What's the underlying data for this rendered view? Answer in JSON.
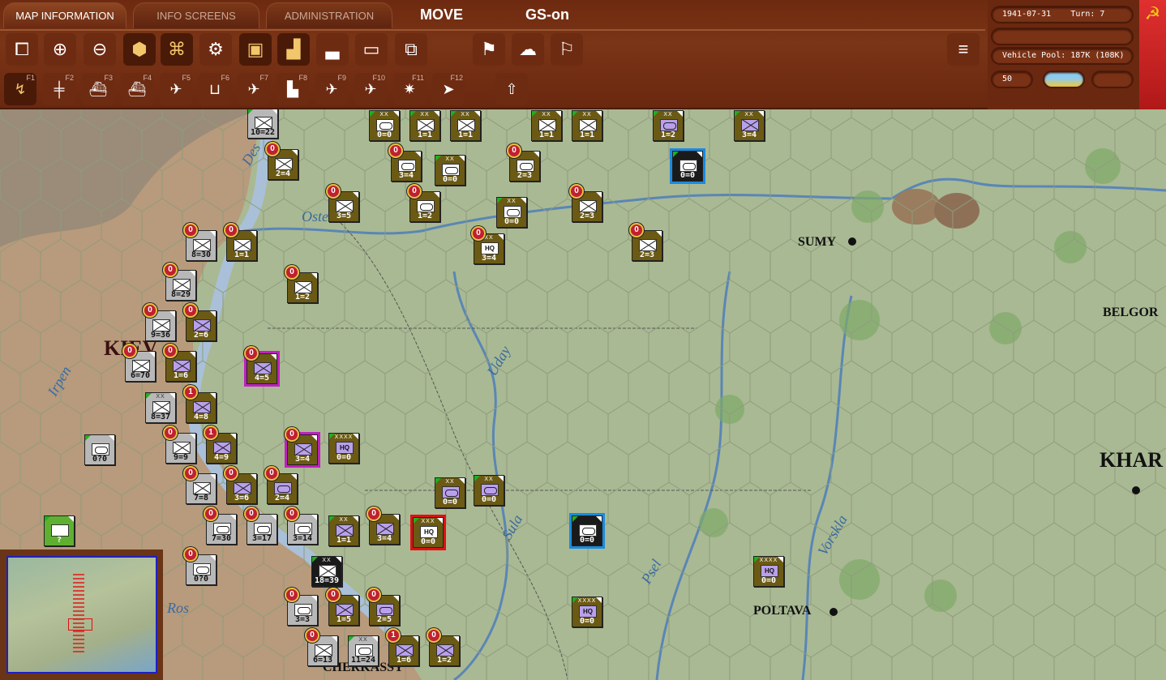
{
  "tabs": [
    {
      "label": "MAP INFORMATION",
      "active": true
    },
    {
      "label": "INFO SCREENS"
    },
    {
      "label": "ADMINISTRATION"
    }
  ],
  "modes": {
    "move": "MOVE",
    "gs": "GS-on"
  },
  "toolbar1": [
    {
      "icon": "windows-icon"
    },
    {
      "icon": "zoom-in-icon"
    },
    {
      "icon": "zoom-out-icon"
    },
    {
      "icon": "hex-grid-icon"
    },
    {
      "icon": "zoc-icon"
    },
    {
      "icon": "gear-icon"
    },
    {
      "icon": "unit-display-icon"
    },
    {
      "icon": "unit-stats-icon"
    },
    {
      "icon": "factory-icon"
    },
    {
      "icon": "frame-icon"
    },
    {
      "icon": "unit-frame-icon"
    },
    {
      "icon": "end-turn-flag-icon"
    },
    {
      "icon": "weather-icon"
    },
    {
      "icon": "flag-icon"
    },
    {
      "icon": "stack-icon"
    }
  ],
  "toolbar2": [
    {
      "icon": "move-mode-icon",
      "key": "F1"
    },
    {
      "icon": "rail-icon",
      "key": "F2"
    },
    {
      "icon": "naval-transport-icon",
      "key": "F3"
    },
    {
      "icon": "amphibious-icon",
      "key": "F4"
    },
    {
      "icon": "recon-air-icon",
      "key": "F5"
    },
    {
      "icon": "airfield-bomb-icon",
      "key": "F6"
    },
    {
      "icon": "air-superiority-icon",
      "key": "F7"
    },
    {
      "icon": "city-bomb-icon",
      "key": "F8"
    },
    {
      "icon": "airdrop-icon",
      "key": "F9"
    },
    {
      "icon": "ground-attack-icon",
      "key": "F10"
    },
    {
      "icon": "explosion-icon",
      "key": "F11"
    },
    {
      "icon": "play-icon",
      "key": "F12"
    },
    {
      "icon": "upload-icon",
      "key": ""
    }
  ],
  "status": {
    "date": "1941-07-31",
    "turn": "Turn: 7",
    "vehicle_pool": "Vehicle Pool: 187K (108K)",
    "value": "50"
  },
  "map": {
    "cities": [
      "SUMY",
      "BELGOR",
      "KHAR",
      "POLTAVA",
      "CHERKASSY",
      "KIEV"
    ],
    "rivers": [
      "Des",
      "Oster",
      "Irpen",
      "Uday",
      "Sula",
      "Psel",
      "Vorskla",
      "Ros"
    ],
    "counters": [
      {
        "st": "10=22",
        "sz": "",
        "c": "gray",
        "s": "x",
        "b": ""
      },
      {
        "st": "0=0",
        "sz": "XX",
        "c": "olive",
        "s": "oval",
        "b": ""
      },
      {
        "st": "1=1",
        "sz": "XX",
        "c": "olive",
        "s": "x",
        "b": ""
      },
      {
        "st": "1=1",
        "sz": "XX",
        "c": "olive",
        "s": "x",
        "b": ""
      },
      {
        "st": "1=1",
        "sz": "XX",
        "c": "olive",
        "s": "x",
        "b": ""
      },
      {
        "st": "1=1",
        "sz": "XX",
        "c": "olive",
        "s": "x",
        "b": ""
      },
      {
        "st": "1=2",
        "sz": "XX",
        "c": "olive",
        "s": "oval",
        "b": "",
        "p": true
      },
      {
        "st": "3=4",
        "sz": "XX",
        "c": "olive",
        "s": "x",
        "b": "",
        "p": true
      },
      {
        "st": "2=4",
        "sz": "",
        "c": "olive",
        "s": "x",
        "b": "0"
      },
      {
        "st": "3=4",
        "sz": "",
        "c": "olive",
        "s": "oval",
        "b": "0"
      },
      {
        "st": "0=0",
        "sz": "XX",
        "c": "olive",
        "s": "oval",
        "b": ""
      },
      {
        "st": "2=3",
        "sz": "",
        "c": "olive",
        "s": "oval",
        "b": "0"
      },
      {
        "st": "0=0",
        "sz": "",
        "c": "black",
        "s": "oval",
        "b": "",
        "o": "blue"
      },
      {
        "st": "3=5",
        "sz": "",
        "c": "olive",
        "s": "x",
        "b": "0"
      },
      {
        "st": "1=2",
        "sz": "",
        "c": "olive",
        "s": "oval",
        "b": "0"
      },
      {
        "st": "0=0",
        "sz": "XX",
        "c": "olive",
        "s": "oval",
        "b": ""
      },
      {
        "st": "2=3",
        "sz": "",
        "c": "olive",
        "s": "x",
        "b": "0"
      },
      {
        "st": "8=30",
        "sz": "",
        "c": "gray",
        "s": "x",
        "b": "0"
      },
      {
        "st": "1=1",
        "sz": "",
        "c": "olive",
        "s": "x",
        "b": "0"
      },
      {
        "st": "3=4",
        "sz": "XX",
        "c": "olive",
        "s": "hq",
        "b": "0",
        "t": "HQ"
      },
      {
        "st": "2=3",
        "sz": "",
        "c": "olive",
        "s": "x",
        "b": "0"
      },
      {
        "st": "8=29",
        "sz": "",
        "c": "gray",
        "s": "x",
        "b": "0"
      },
      {
        "st": "1=2",
        "sz": "",
        "c": "olive",
        "s": "x",
        "b": "0"
      },
      {
        "st": "9=36",
        "sz": "",
        "c": "gray",
        "s": "x",
        "b": "0"
      },
      {
        "st": "2=6",
        "sz": "",
        "c": "olive",
        "s": "x",
        "b": "0",
        "p": true
      },
      {
        "st": "6=70",
        "sz": "",
        "c": "gray",
        "s": "x",
        "b": "0"
      },
      {
        "st": "1=6",
        "sz": "",
        "c": "olive",
        "s": "x",
        "b": "0",
        "p": true
      },
      {
        "st": "4=5",
        "sz": "",
        "c": "olive",
        "s": "x",
        "b": "0",
        "p": true,
        "o": "mag"
      },
      {
        "st": "8=37",
        "sz": "XX",
        "c": "gray",
        "s": "x",
        "b": ""
      },
      {
        "st": "4=8",
        "sz": "",
        "c": "olive",
        "s": "x",
        "b": "1",
        "p": true
      },
      {
        "st": "0?0",
        "sz": "",
        "c": "gray",
        "s": "oval",
        "b": ""
      },
      {
        "st": "9=9",
        "sz": "",
        "c": "gray",
        "s": "x",
        "b": "0"
      },
      {
        "st": "4=9",
        "sz": "",
        "c": "olive",
        "s": "x",
        "b": "1",
        "p": true
      },
      {
        "st": "3=4",
        "sz": "",
        "c": "olive",
        "s": "x",
        "b": "0",
        "p": true,
        "o": "mag"
      },
      {
        "st": "0=0",
        "sz": "XXXX",
        "c": "olive",
        "s": "hq",
        "b": "",
        "p": true,
        "t": "HQ"
      },
      {
        "st": "7=8",
        "sz": "",
        "c": "gray",
        "s": "x",
        "b": "0"
      },
      {
        "st": "3=6",
        "sz": "",
        "c": "olive",
        "s": "x",
        "b": "0",
        "p": true
      },
      {
        "st": "2=4",
        "sz": "",
        "c": "olive",
        "s": "oval",
        "b": "0",
        "p": true
      },
      {
        "st": "0=0",
        "sz": "XX",
        "c": "olive",
        "s": "oval",
        "b": "",
        "p": true
      },
      {
        "st": "0=0",
        "sz": "XX",
        "c": "olive",
        "s": "oval",
        "b": "",
        "p": true
      },
      {
        "st": "7=30",
        "sz": "",
        "c": "gray",
        "s": "oval",
        "b": "0"
      },
      {
        "st": "3=17",
        "sz": "",
        "c": "gray",
        "s": "oval",
        "b": "0"
      },
      {
        "st": "3=14",
        "sz": "",
        "c": "gray",
        "s": "oval",
        "b": "0"
      },
      {
        "st": "1=1",
        "sz": "XX",
        "c": "olive",
        "s": "x",
        "b": "",
        "p": true
      },
      {
        "st": "3=4",
        "sz": "",
        "c": "olive",
        "s": "x",
        "b": "0",
        "p": true
      },
      {
        "st": "0=0",
        "sz": "XXX",
        "c": "olive",
        "s": "hq",
        "b": "",
        "o": "red",
        "t": "HQ"
      },
      {
        "st": "0=0",
        "sz": "",
        "c": "black",
        "s": "oval",
        "b": "",
        "o": "blue"
      },
      {
        "st": "?",
        "sz": "",
        "c": "green",
        "s": "blank",
        "b": ""
      },
      {
        "st": "0?0",
        "sz": "",
        "c": "gray",
        "s": "oval",
        "b": "0"
      },
      {
        "st": "18=39",
        "sz": "XX",
        "c": "black",
        "s": "x",
        "b": ""
      },
      {
        "st": "0=0",
        "sz": "XXXX",
        "c": "olive",
        "s": "hq",
        "b": "",
        "p": true,
        "t": "HQ"
      },
      {
        "st": "3=3",
        "sz": "",
        "c": "gray",
        "s": "oval",
        "b": "0"
      },
      {
        "st": "1=5",
        "sz": "",
        "c": "olive",
        "s": "x",
        "b": "0",
        "p": true
      },
      {
        "st": "2=5",
        "sz": "",
        "c": "olive",
        "s": "oval",
        "b": "0",
        "p": true
      },
      {
        "st": "0=0",
        "sz": "XXXX",
        "c": "olive",
        "s": "hq",
        "b": "",
        "p": true,
        "t": "HQ"
      },
      {
        "st": "6=13",
        "sz": "",
        "c": "gray",
        "s": "x",
        "b": "0"
      },
      {
        "st": "11=24",
        "sz": "XX",
        "c": "gray",
        "s": "oval",
        "b": ""
      },
      {
        "st": "1=6",
        "sz": "",
        "c": "olive",
        "s": "x",
        "b": "1",
        "p": true
      },
      {
        "st": "1=2",
        "sz": "",
        "c": "olive",
        "s": "x",
        "b": "0",
        "p": true
      }
    ]
  },
  "colors": {
    "bar": "#6e2a10",
    "map": "#a9b993",
    "olive": "#6b5a14"
  }
}
